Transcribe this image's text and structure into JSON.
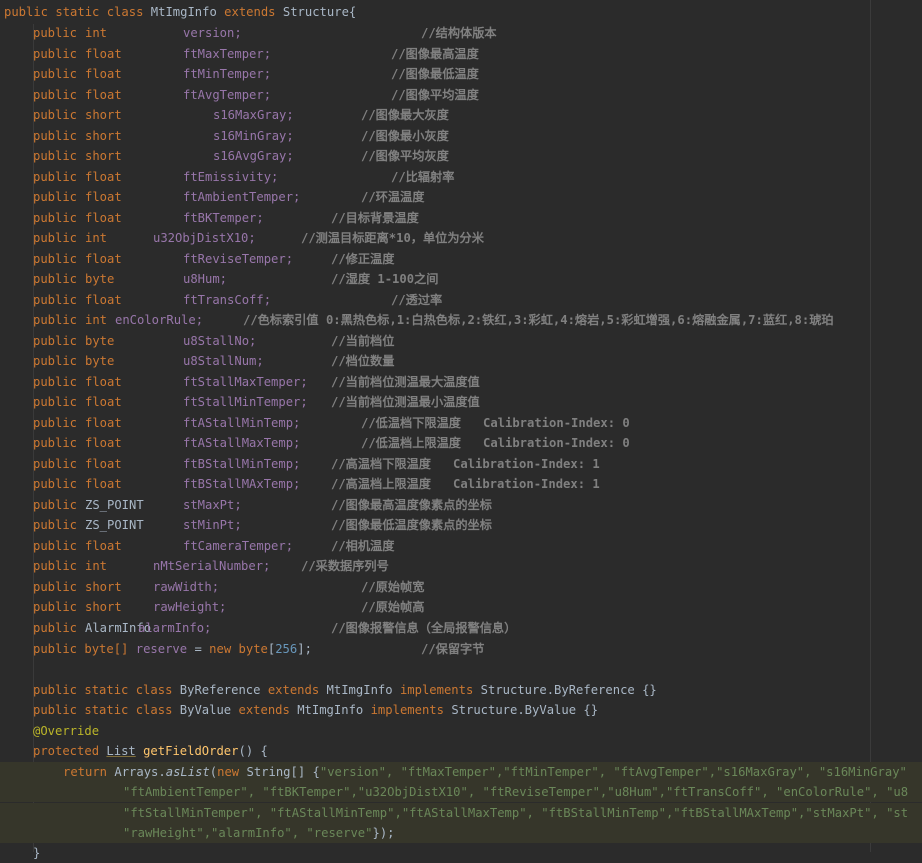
{
  "code": {
    "class_decl": {
      "kw": "public static class",
      "name": "MtImgInfo",
      "ext": "extends",
      "parent": "Structure",
      "brace": "{"
    },
    "fields": [
      {
        "mod": "public",
        "type": "int",
        "name": "version;",
        "comment": "//结构体版本"
      },
      {
        "mod": "public",
        "type": "float",
        "name": "ftMaxTemper;",
        "comment": "//图像最高温度"
      },
      {
        "mod": "public",
        "type": "float",
        "name": "ftMinTemper;",
        "comment": "//图像最低温度"
      },
      {
        "mod": "public",
        "type": "float",
        "name": "ftAvgTemper;",
        "comment": "//图像平均温度"
      },
      {
        "mod": "public",
        "type": "short",
        "name": "s16MaxGray;",
        "comment": "//图像最大灰度"
      },
      {
        "mod": "public",
        "type": "short",
        "name": "s16MinGray;",
        "comment": "//图像最小灰度"
      },
      {
        "mod": "public",
        "type": "short",
        "name": "s16AvgGray;",
        "comment": "//图像平均灰度"
      },
      {
        "mod": "public",
        "type": "float",
        "name": "ftEmissivity;",
        "comment": "//比辐射率"
      },
      {
        "mod": "public",
        "type": "float",
        "name": "ftAmbientTemper;",
        "comment": "//环温温度"
      },
      {
        "mod": "public",
        "type": "float",
        "name": "ftBKTemper;",
        "comment": "//目标背景温度"
      },
      {
        "mod": "public",
        "type": "int",
        "name": "u32ObjDistX10;",
        "comment": "//测温目标距离*10，单位为分米"
      },
      {
        "mod": "public",
        "type": "float",
        "name": "ftReviseTemper;",
        "comment": "//修正温度"
      },
      {
        "mod": "public",
        "type": "byte",
        "name": "u8Hum;",
        "comment": "//湿度 1-100之间"
      },
      {
        "mod": "public",
        "type": "float",
        "name": "ftTransCoff;",
        "comment": "//透过率"
      },
      {
        "mod": "public",
        "type": "int",
        "name": "enColorRule;",
        "comment": "//色标索引值 0:黑热色标,1:白热色标,2:铁红,3:彩虹,4:熔岩,5:彩虹增强,6:熔融金属,7:蓝红,8:琥珀"
      },
      {
        "mod": "public",
        "type": "byte",
        "name": "u8StallNo;",
        "comment": "//当前档位"
      },
      {
        "mod": "public",
        "type": "byte",
        "name": "u8StallNum;",
        "comment": "//档位数量"
      },
      {
        "mod": "public",
        "type": "float",
        "name": "ftStallMaxTemper;",
        "comment": "//当前档位测温最大温度值"
      },
      {
        "mod": "public",
        "type": "float",
        "name": "ftStallMinTemper;",
        "comment": "//当前档位测温最小温度值"
      },
      {
        "mod": "public",
        "type": "float",
        "name": "ftAStallMinTemp;",
        "comment": "//低温档下限温度   Calibration-Index: 0"
      },
      {
        "mod": "public",
        "type": "float",
        "name": "ftAStallMaxTemp;",
        "comment": "//低温档上限温度   Calibration-Index: 0"
      },
      {
        "mod": "public",
        "type": "float",
        "name": "ftBStallMinTemp;",
        "comment": "//高温档下限温度   Calibration-Index: 1"
      },
      {
        "mod": "public",
        "type": "float",
        "name": "ftBStallMAxTemp;",
        "comment": "//高温档上限温度   Calibration-Index: 1"
      },
      {
        "mod": "public",
        "type": "ZS_POINT",
        "name": "stMaxPt;",
        "comment": "//图像最高温度像素点的坐标"
      },
      {
        "mod": "public",
        "type": "ZS_POINT",
        "name": "stMinPt;",
        "comment": "//图像最低温度像素点的坐标"
      },
      {
        "mod": "public",
        "type": "float",
        "name": "ftCameraTemper;",
        "comment": "//相机温度"
      },
      {
        "mod": "public",
        "type": "int",
        "name": "nMtSerialNumber;",
        "comment": "//采数据序列号"
      },
      {
        "mod": "public",
        "type": "short",
        "name": "rawWidth;",
        "comment": "//原始帧宽"
      },
      {
        "mod": "public",
        "type": "short",
        "name": "rawHeight;",
        "comment": "//原始帧高"
      },
      {
        "mod": "public",
        "type": "AlarmInfo",
        "name": "alarmInfo;",
        "comment": "//图像报警信息（全局报警信息）"
      }
    ],
    "reserve": {
      "mod": "public",
      "type": "byte[]",
      "name": "reserve",
      "eq": "=",
      "new": "new",
      "arrtype": "byte",
      "lb": "[",
      "size": "256",
      "rb": "];",
      "comment": "//保留字节"
    },
    "byref": {
      "kw": "public static class",
      "name": "ByReference",
      "ext": "extends",
      "parent": "MtImgInfo",
      "impl": "implements",
      "iface": "Structure.ByReference",
      "body": "{}"
    },
    "byval": {
      "kw": "public static class",
      "name": "ByValue",
      "ext": "extends",
      "parent": "MtImgInfo",
      "impl": "implements",
      "iface": "Structure.ByValue",
      "body": "{}"
    },
    "annotation": "@Override",
    "method": {
      "kw": "protected",
      "type": "List",
      "name": "getFieldOrder",
      "parens": "()",
      "brace": "{"
    },
    "ret": {
      "kw": "return",
      "cls": "Arrays.",
      "call": "asList",
      "lp": "(",
      "new": "new",
      "type": "String[]",
      "open": "{"
    },
    "strings_line1": "\"version\", \"ftMaxTemper\",\"ftMinTemper\", \"ftAvgTemper\",\"s16MaxGray\", \"s16MinGray\"",
    "strings_line2": "\"ftAmbientTemper\", \"ftBKTemper\",\"u32ObjDistX10\", \"ftReviseTemper\",\"u8Hum\",\"ftTransCoff\", \"enColorRule\", \"u8",
    "strings_line3": "\"ftStallMinTemper\", \"ftAStallMinTemp\",\"ftAStallMaxTemp\", \"ftBStallMinTemp\",\"ftBStallMAxTemp\",\"stMaxPt\", \"st",
    "strings_line4": "\"rawHeight\",\"alarmInfo\", \"reserve\"",
    "close_call": "});",
    "close_brace": "}"
  },
  "colors": {
    "background": "#2b2b2b",
    "keyword": "#cc7832",
    "field": "#9876aa",
    "comment": "#808080",
    "string": "#6a8759",
    "number": "#6897bb",
    "annotation": "#bbb529"
  }
}
